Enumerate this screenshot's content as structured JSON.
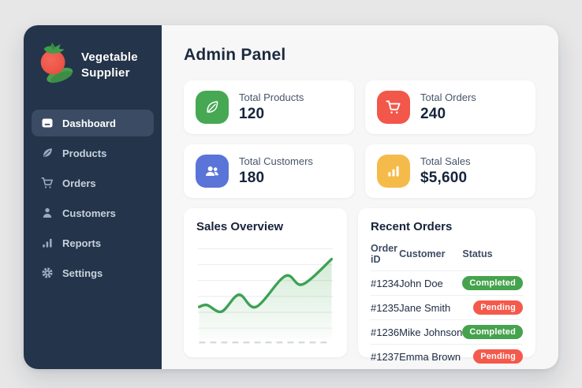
{
  "app": {
    "outer_background": "#e7e7e8",
    "sidebar_color": "#24344a"
  },
  "sidebar": {
    "brand": {
      "line1": "Vegetable",
      "line2": "Supplier",
      "logo": "tomato-icon"
    },
    "items": [
      {
        "label": "Dashboard",
        "icon": "dashboard-icon",
        "active": true
      },
      {
        "label": "Products",
        "icon": "leaf-icon",
        "active": false
      },
      {
        "label": "Orders",
        "icon": "cart-icon",
        "active": false
      },
      {
        "label": "Customers",
        "icon": "user-icon",
        "active": false
      },
      {
        "label": "Reports",
        "icon": "bar-chart-icon",
        "active": false
      },
      {
        "label": "Settings",
        "icon": "gear-icon",
        "active": false
      }
    ]
  },
  "header": {
    "title": "Admin Panel"
  },
  "stats": [
    {
      "label": "Total Products",
      "value": "120",
      "icon": "leaf-icon",
      "accent": "#46a853"
    },
    {
      "label": "Total Orders",
      "value": "240",
      "icon": "cart-icon",
      "accent": "#f2574a"
    },
    {
      "label": "Total Customers",
      "value": "180",
      "icon": "users-icon",
      "accent": "#5b74d8"
    },
    {
      "label": "Total Sales",
      "value": "$5,600",
      "icon": "bar-chart-icon",
      "accent": "#f5bb4a"
    }
  ],
  "sales_overview": {
    "title": "Sales Overview"
  },
  "chart_data": {
    "type": "line",
    "title": "Sales Overview",
    "x": [
      0,
      6,
      17,
      30,
      43,
      65,
      78,
      100
    ],
    "values": [
      38,
      40,
      33,
      51,
      38,
      71,
      62,
      89
    ],
    "ylim": [
      0,
      100
    ],
    "xlabel": "",
    "ylabel": "",
    "grid": true,
    "legend": false,
    "line_color": "#3da155",
    "fill": "green-gradient-to-transparent"
  },
  "recent_orders": {
    "title": "Recent Orders",
    "columns": [
      "Order iD",
      "Customer",
      "Status"
    ],
    "rows": [
      {
        "order_id": "#1234",
        "customer": "John Doe",
        "status": "Completed"
      },
      {
        "order_id": "#1235",
        "customer": "Jane Smith",
        "status": "Pending"
      },
      {
        "order_id": "#1236",
        "customer": "Mike Johnson",
        "status": "Completed"
      },
      {
        "order_id": "#1237",
        "customer": "Emma Brown",
        "status": "Pending"
      }
    ],
    "status_colors": {
      "Completed": "#45a34d",
      "Pending": "#f4594b"
    }
  }
}
